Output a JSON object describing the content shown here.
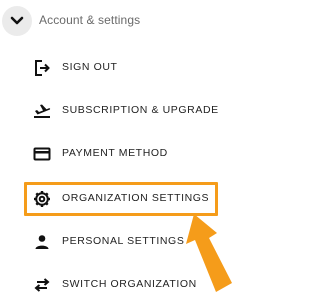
{
  "header": {
    "title": "Account & settings",
    "collapse_icon": "chevron-down-icon"
  },
  "menu": {
    "items": [
      {
        "label": "SIGN OUT",
        "icon": "sign-out-icon"
      },
      {
        "label": "SUBSCRIPTION & UPGRADE",
        "icon": "plane-takeoff-icon"
      },
      {
        "label": "PAYMENT METHOD",
        "icon": "credit-card-icon"
      },
      {
        "label": "ORGANIZATION SETTINGS",
        "icon": "gear-icon",
        "highlighted": true
      },
      {
        "label": "PERSONAL SETTINGS",
        "icon": "person-icon"
      },
      {
        "label": "SWITCH ORGANIZATION",
        "icon": "swap-arrows-icon"
      }
    ]
  },
  "annotation": {
    "highlight_color": "#f59c1a",
    "arrow_icon": "pointer-arrow-icon"
  }
}
